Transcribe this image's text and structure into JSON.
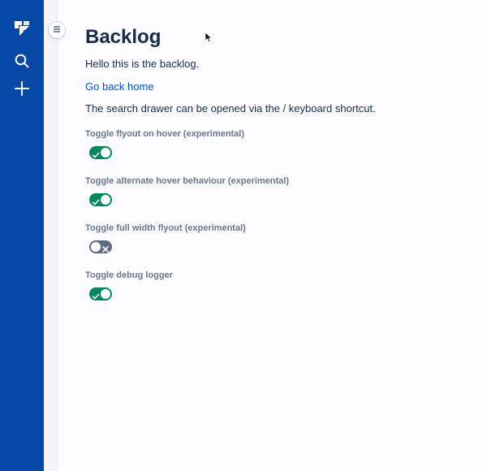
{
  "colors": {
    "nav_background": "#0747a6",
    "link": "#0052cc",
    "toggle_on": "#00875a",
    "toggle_off": "#5e6c84"
  },
  "global_nav": {
    "items": [
      {
        "icon": "jira-logo-icon"
      },
      {
        "icon": "search-icon"
      },
      {
        "icon": "create-plus-icon"
      }
    ]
  },
  "sidebar": {
    "collapse_icon": "menu-icon"
  },
  "page": {
    "title": "Backlog",
    "intro": "Hello this is the backlog.",
    "home_link": "Go back home",
    "shortcut_text": "The search drawer can be opened via the / keyboard shortcut."
  },
  "toggles": [
    {
      "label": "Toggle flyout on hover (experimental)",
      "checked": true
    },
    {
      "label": "Toggle alternate hover behaviour (experimental)",
      "checked": true
    },
    {
      "label": "Toggle full width flyout (experimental)",
      "checked": false
    },
    {
      "label": "Toggle debug logger",
      "checked": true
    }
  ]
}
